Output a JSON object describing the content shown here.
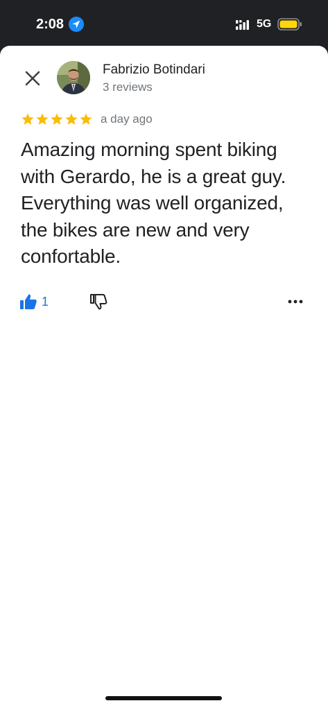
{
  "status_bar": {
    "time": "2:08",
    "network": "5G",
    "location_icon": "location-arrow-icon",
    "signal_icon": "signal-icon",
    "battery_icon": "battery-icon",
    "battery_color": "#ffd60a"
  },
  "review": {
    "close_icon": "close-icon",
    "author_name": "Fabrizio Botindari",
    "author_reviews": "3 reviews",
    "rating": 5,
    "rating_max": 5,
    "star_color": "#fbbc04",
    "date": "a day ago",
    "text": "Amazing morning spent biking with Gerardo, he is a great guy. Everything was well organized, the bikes are new and very confortable.",
    "likes_count": "1",
    "like_color": "#1a73e8"
  },
  "actions": {
    "like_icon": "thumbs-up-icon",
    "dislike_icon": "thumbs-down-icon",
    "more_icon": "more-horizontal-icon"
  }
}
